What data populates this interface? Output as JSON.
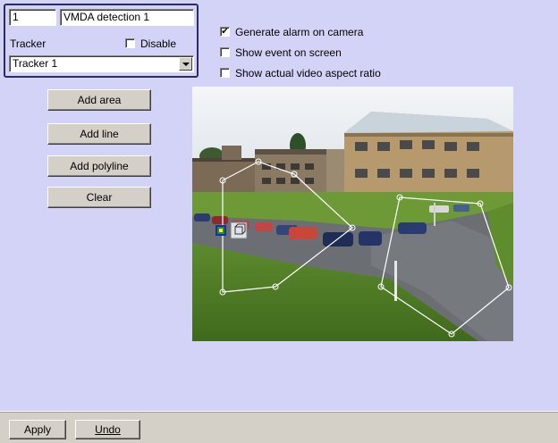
{
  "object": {
    "id": "1",
    "name": "VMDA detection 1",
    "tracker_label": "Tracker",
    "disable_label": "Disable",
    "disable_checked": false,
    "tracker_value": "Tracker 1"
  },
  "options": {
    "generate_alarm": {
      "label": "Generate alarm on camera",
      "checked": true
    },
    "show_event": {
      "label": "Show event on screen",
      "checked": false
    },
    "aspect_ratio": {
      "label": "Show actual video aspect ratio",
      "checked": false
    }
  },
  "tools": {
    "add_area": "Add area",
    "add_line": "Add line",
    "add_polyline": "Add polyline",
    "clear": "Clear"
  },
  "footer": {
    "apply": "Apply",
    "undo": "Undo"
  },
  "colors": {
    "background": "#d3d3f7",
    "control_face": "#d4d0c8",
    "zone_outline": "#ffffff",
    "selected_handle": "#2a8a2a"
  },
  "icons": {
    "check": "✔"
  }
}
